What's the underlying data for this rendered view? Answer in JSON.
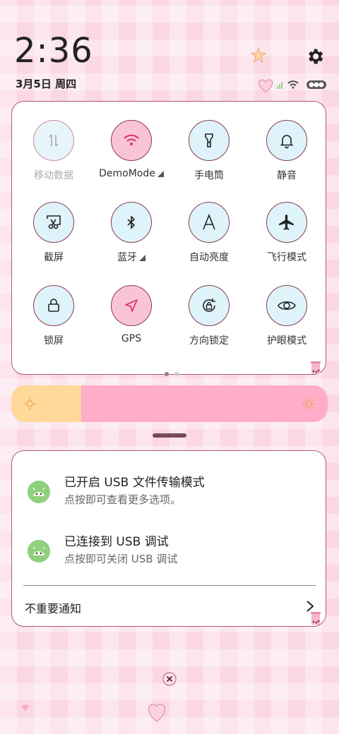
{
  "clock": {
    "time": "2:36",
    "date": "3月5日 周四"
  },
  "colors": {
    "accent_pink": "#f8c4d6",
    "tile_blue": "#dff3fb",
    "border": "#b2596f",
    "brightness_fill": "#ffd999",
    "brightness_track": "#ffadc8",
    "notif_icon": "#8fd07f"
  },
  "quick_settings": {
    "tiles": [
      {
        "label": "移动数据",
        "icon": "mobile-data-icon",
        "state": "disabled"
      },
      {
        "label": "DemoMode",
        "icon": "wifi-icon",
        "state": "on",
        "has_more": true
      },
      {
        "label": "手电筒",
        "icon": "flashlight-icon",
        "state": "off"
      },
      {
        "label": "静音",
        "icon": "bell-icon",
        "state": "off"
      },
      {
        "label": "截屏",
        "icon": "screenshot-icon",
        "state": "off"
      },
      {
        "label": "蓝牙",
        "icon": "bluetooth-icon",
        "state": "off",
        "has_more": true
      },
      {
        "label": "自动亮度",
        "icon": "auto-brightness-icon",
        "state": "off"
      },
      {
        "label": "飞行模式",
        "icon": "airplane-icon",
        "state": "off"
      },
      {
        "label": "锁屏",
        "icon": "lock-icon",
        "state": "off"
      },
      {
        "label": "GPS",
        "icon": "gps-icon",
        "state": "on"
      },
      {
        "label": "方向锁定",
        "icon": "rotation-lock-icon",
        "state": "off"
      },
      {
        "label": "护眼模式",
        "icon": "eye-icon",
        "state": "off"
      }
    ],
    "page_count": 2,
    "current_page": 1
  },
  "brightness": {
    "level": 0.22
  },
  "notifications": [
    {
      "title": "已开启 USB 文件传输模式",
      "subtitle": "点按即可查看更多选项。",
      "icon": "android-face-icon"
    },
    {
      "title": "已连接到 USB 调试",
      "subtitle": "点按即可关闭 USB 调试",
      "icon": "android-face-icon"
    }
  ],
  "less_important": {
    "label": "不重要通知"
  }
}
